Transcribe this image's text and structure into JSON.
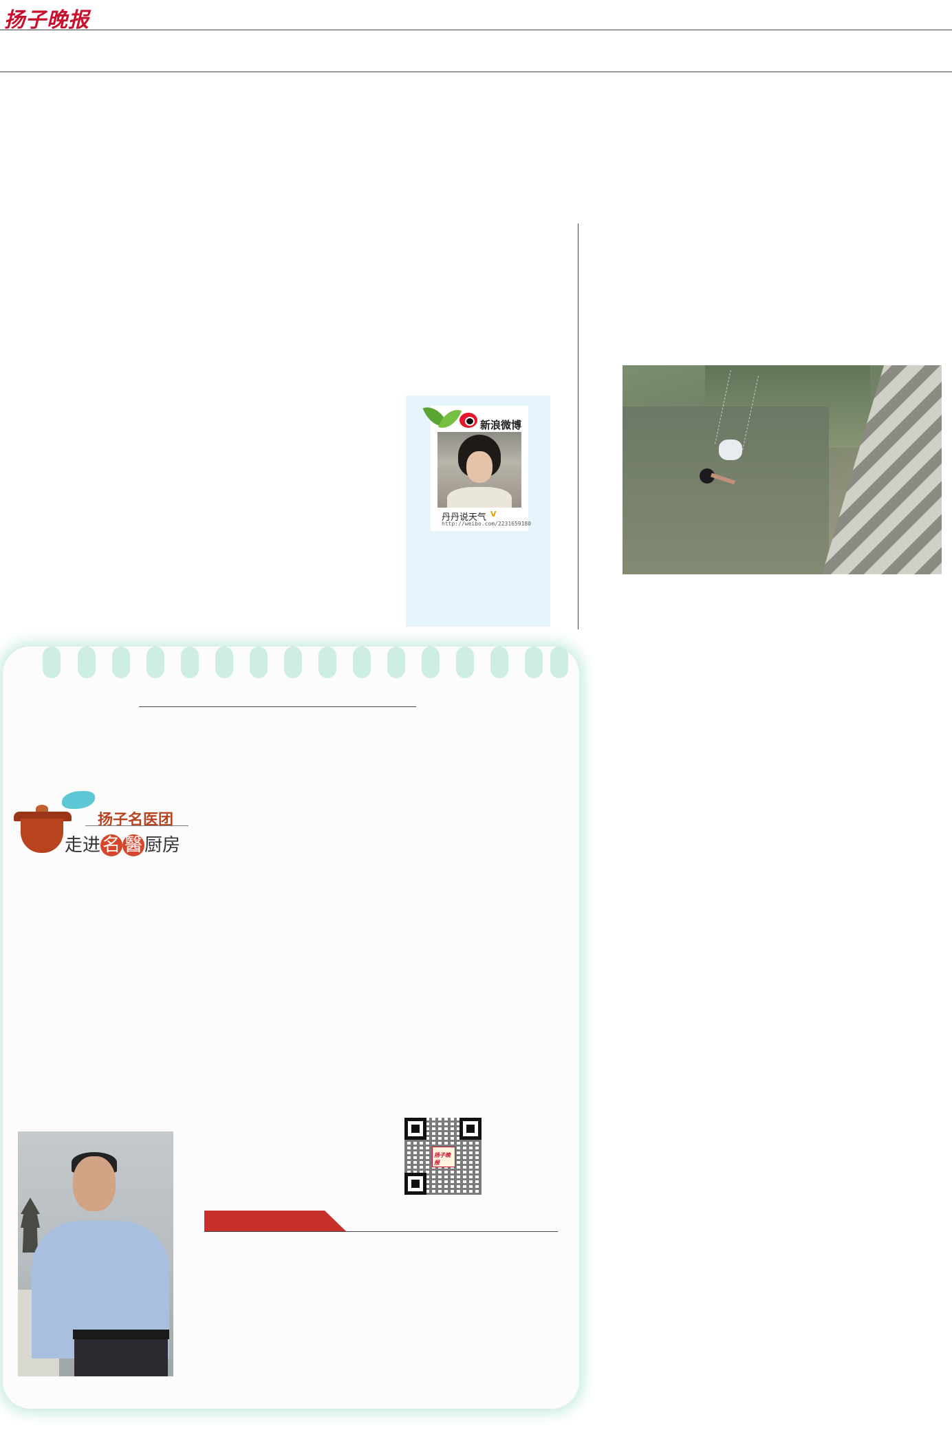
{
  "masthead": {
    "logo": "扬子晚报"
  },
  "weibo": {
    "brand": "新浪微博",
    "account_name": "丹丹说天气",
    "verified_mark": "V",
    "url": "http://weibo.com/2231659180",
    "leaf_color": "#5aa632",
    "logo_color": "#e6162d",
    "box_color": "#e6f4fc"
  },
  "column_logo": {
    "top_text": "扬子名医团",
    "bottom_pre": "走进",
    "bottom_circle1": "名",
    "bottom_circle2": "醫",
    "bottom_post": "厨房",
    "accent_color": "#d4472a"
  },
  "qr": {
    "center_logo": "扬子晚报"
  },
  "colors": {
    "brand_red": "#c8102e",
    "notepad_glow": "#cfeee3",
    "tab_red": "#c8302b"
  }
}
